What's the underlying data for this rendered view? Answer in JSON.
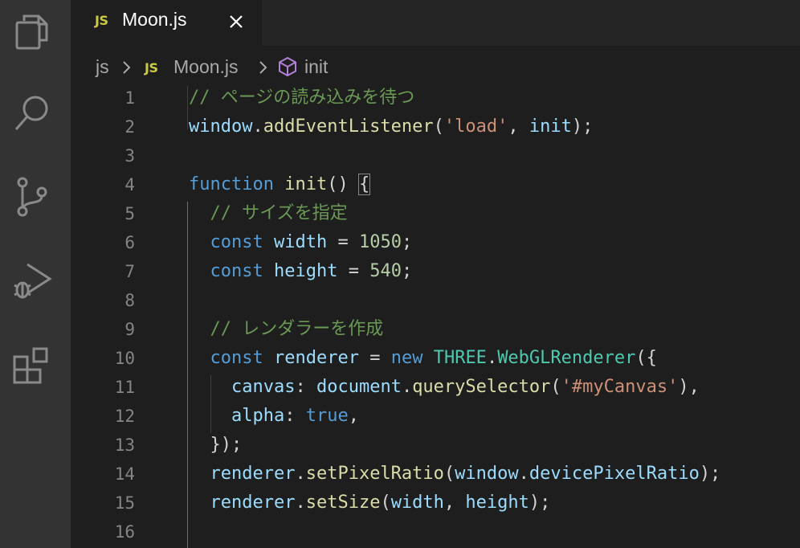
{
  "activity_bar": {
    "icons": [
      "explorer-icon",
      "search-icon",
      "source-control-icon",
      "run-debug-icon",
      "extensions-icon"
    ]
  },
  "tab": {
    "badge": "JS",
    "title": "Moon.js",
    "close_glyph": "×"
  },
  "breadcrumb": {
    "folder": "js",
    "file_badge": "JS",
    "file": "Moon.js",
    "symbol": "init"
  },
  "editor": {
    "lines": [
      {
        "number": "1",
        "tokens": [
          [
            "comment",
            "// ページの読み込みを待つ"
          ]
        ]
      },
      {
        "number": "2",
        "tokens": [
          [
            "var",
            "window"
          ],
          [
            "punct",
            "."
          ],
          [
            "func",
            "addEventListener"
          ],
          [
            "punct",
            "("
          ],
          [
            "string",
            "'load'"
          ],
          [
            "punct",
            ", "
          ],
          [
            "var",
            "init"
          ],
          [
            "punct",
            ");"
          ]
        ]
      },
      {
        "number": "3",
        "tokens": []
      },
      {
        "number": "4",
        "tokens": [
          [
            "keyword",
            "function"
          ],
          [
            "punct",
            " "
          ],
          [
            "func",
            "init"
          ],
          [
            "punct",
            "() "
          ],
          [
            "bracket",
            "{"
          ]
        ]
      },
      {
        "number": "5",
        "tokens": [
          [
            "punct",
            "  "
          ],
          [
            "comment",
            "// サイズを指定"
          ]
        ]
      },
      {
        "number": "6",
        "tokens": [
          [
            "punct",
            "  "
          ],
          [
            "keyword",
            "const"
          ],
          [
            "punct",
            " "
          ],
          [
            "var",
            "width"
          ],
          [
            "punct",
            " = "
          ],
          [
            "number",
            "1050"
          ],
          [
            "punct",
            ";"
          ]
        ]
      },
      {
        "number": "7",
        "tokens": [
          [
            "punct",
            "  "
          ],
          [
            "keyword",
            "const"
          ],
          [
            "punct",
            " "
          ],
          [
            "var",
            "height"
          ],
          [
            "punct",
            " = "
          ],
          [
            "number",
            "540"
          ],
          [
            "punct",
            ";"
          ]
        ]
      },
      {
        "number": "8",
        "tokens": []
      },
      {
        "number": "9",
        "tokens": [
          [
            "punct",
            "  "
          ],
          [
            "comment",
            "// レンダラーを作成"
          ]
        ]
      },
      {
        "number": "10",
        "tokens": [
          [
            "punct",
            "  "
          ],
          [
            "keyword",
            "const"
          ],
          [
            "punct",
            " "
          ],
          [
            "var",
            "renderer"
          ],
          [
            "punct",
            " = "
          ],
          [
            "keyword",
            "new"
          ],
          [
            "punct",
            " "
          ],
          [
            "class",
            "THREE"
          ],
          [
            "punct",
            "."
          ],
          [
            "class",
            "WebGLRenderer"
          ],
          [
            "punct",
            "({"
          ]
        ]
      },
      {
        "number": "11",
        "tokens": [
          [
            "punct",
            "    "
          ],
          [
            "var",
            "canvas"
          ],
          [
            "punct",
            ": "
          ],
          [
            "var",
            "document"
          ],
          [
            "punct",
            "."
          ],
          [
            "func",
            "querySelector"
          ],
          [
            "punct",
            "("
          ],
          [
            "string",
            "'#myCanvas'"
          ],
          [
            "punct",
            "),"
          ]
        ]
      },
      {
        "number": "12",
        "tokens": [
          [
            "punct",
            "    "
          ],
          [
            "var",
            "alpha"
          ],
          [
            "punct",
            ": "
          ],
          [
            "keyword",
            "true"
          ],
          [
            "punct",
            ","
          ]
        ]
      },
      {
        "number": "13",
        "tokens": [
          [
            "punct",
            "  "
          ],
          [
            "punct",
            "});"
          ]
        ]
      },
      {
        "number": "14",
        "tokens": [
          [
            "punct",
            "  "
          ],
          [
            "var",
            "renderer"
          ],
          [
            "punct",
            "."
          ],
          [
            "func",
            "setPixelRatio"
          ],
          [
            "punct",
            "("
          ],
          [
            "var",
            "window"
          ],
          [
            "punct",
            "."
          ],
          [
            "var",
            "devicePixelRatio"
          ],
          [
            "punct",
            ");"
          ]
        ]
      },
      {
        "number": "15",
        "tokens": [
          [
            "punct",
            "  "
          ],
          [
            "var",
            "renderer"
          ],
          [
            "punct",
            "."
          ],
          [
            "func",
            "setSize"
          ],
          [
            "punct",
            "("
          ],
          [
            "var",
            "width"
          ],
          [
            "punct",
            ", "
          ],
          [
            "var",
            "height"
          ],
          [
            "punct",
            ");"
          ]
        ]
      },
      {
        "number": "16",
        "tokens": []
      }
    ]
  },
  "colors": {
    "background": "#1e1e1e",
    "activity_bar": "#333333",
    "comment": "#6a9955",
    "keyword": "#569cd6",
    "variable": "#9cdcfe",
    "function": "#dcdcaa",
    "string": "#ce9178",
    "number": "#b5cea8",
    "class": "#4ec9b0",
    "js_badge": "#cbcb41",
    "symbol_cube": "#b180d7"
  }
}
